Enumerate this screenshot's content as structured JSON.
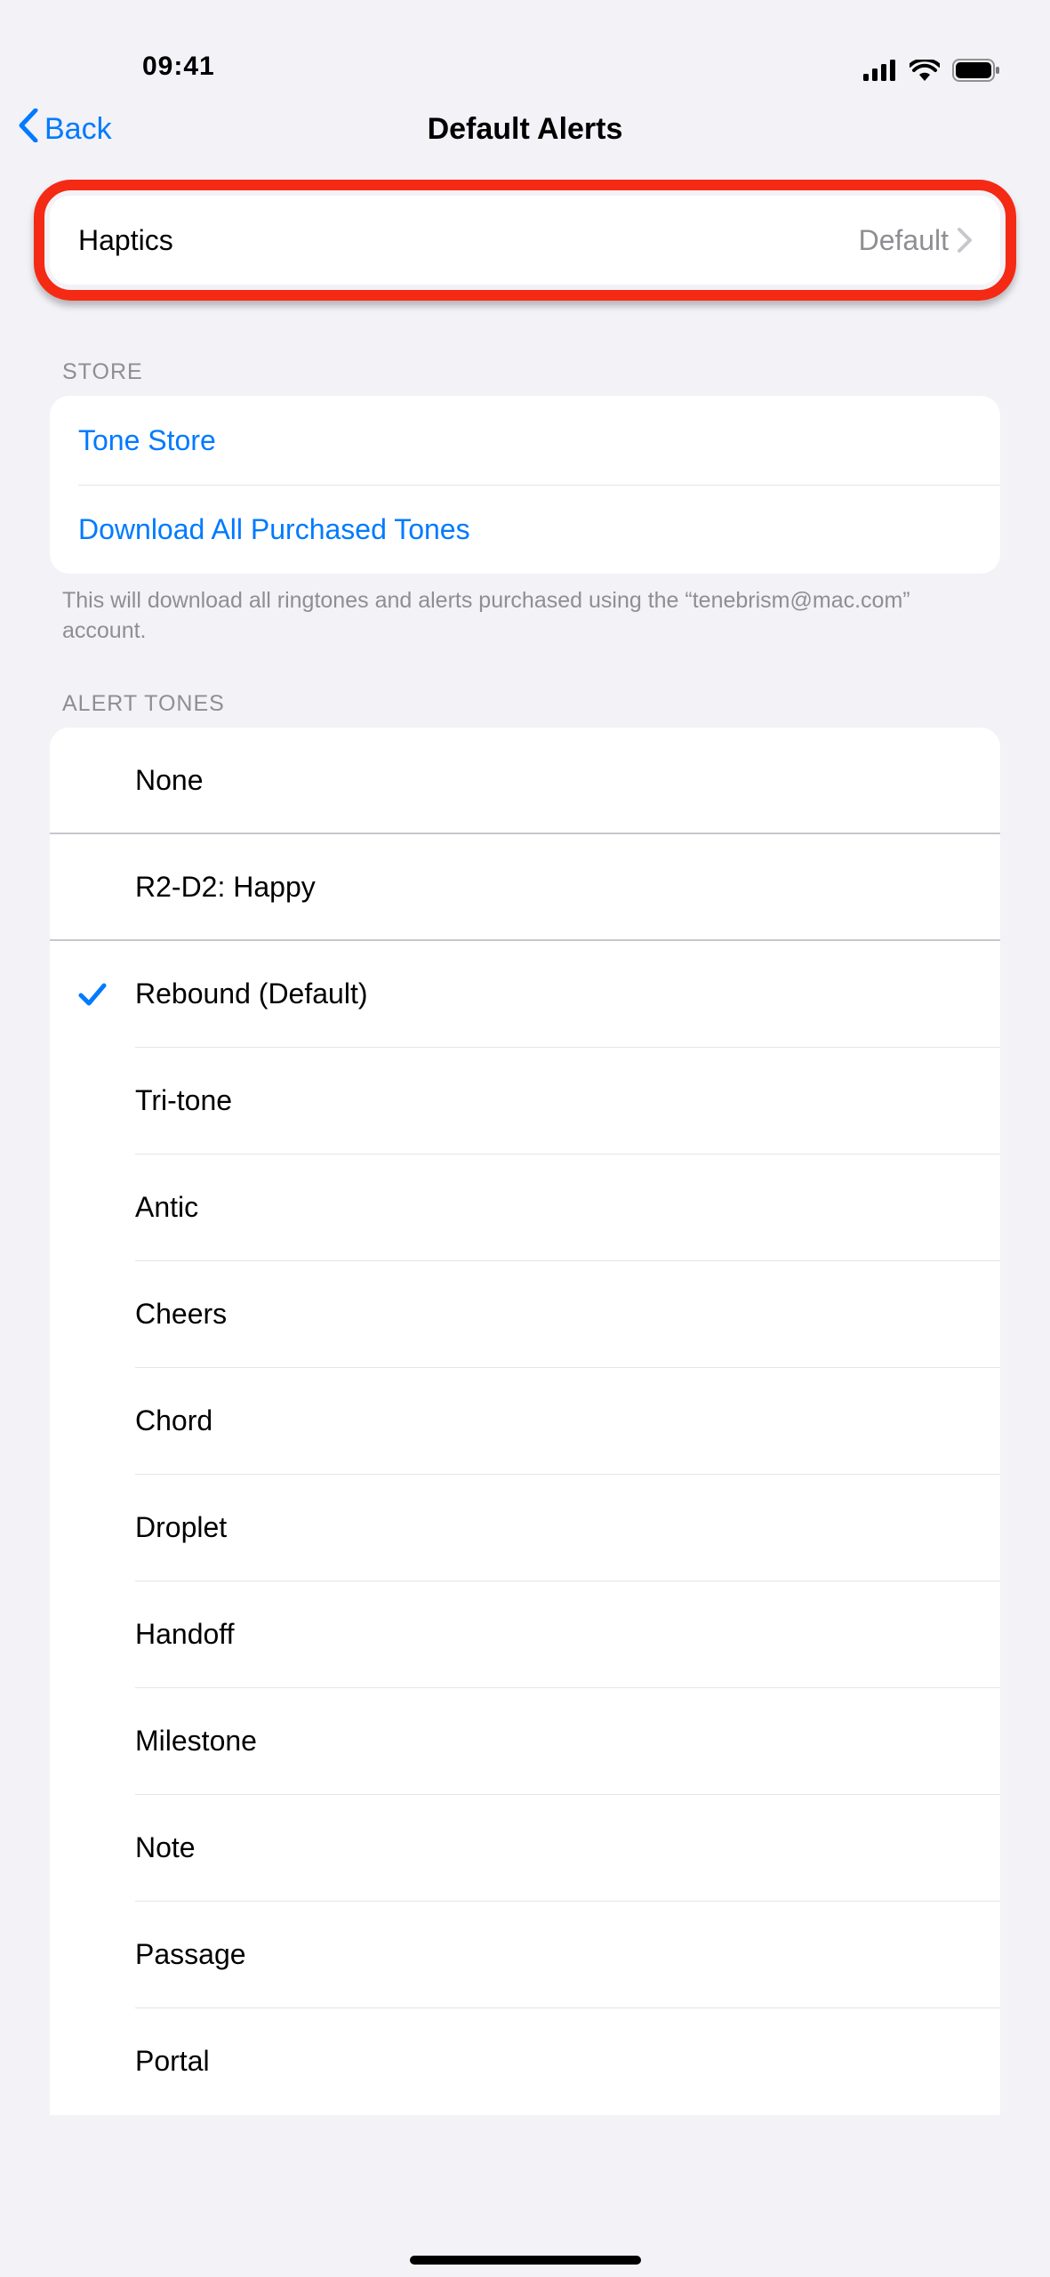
{
  "status": {
    "time": "09:41"
  },
  "nav": {
    "back": "Back",
    "title": "Default Alerts"
  },
  "haptics": {
    "label": "Haptics",
    "value": "Default"
  },
  "store": {
    "header": "STORE",
    "tone_store": "Tone Store",
    "download": "Download All Purchased Tones",
    "footer": "This will download all ringtones and alerts purchased using the “tenebrism@mac.com” account."
  },
  "alert_tones": {
    "header": "ALERT TONES",
    "items": [
      {
        "label": "None",
        "selected": false,
        "style": "full"
      },
      {
        "label": "R2-D2: Happy",
        "selected": false,
        "style": "full"
      },
      {
        "label": "Rebound (Default)",
        "selected": true,
        "style": "inner"
      },
      {
        "label": "Tri-tone",
        "selected": false,
        "style": "inner"
      },
      {
        "label": "Antic",
        "selected": false,
        "style": "inner"
      },
      {
        "label": "Cheers",
        "selected": false,
        "style": "inner"
      },
      {
        "label": "Chord",
        "selected": false,
        "style": "inner"
      },
      {
        "label": "Droplet",
        "selected": false,
        "style": "inner"
      },
      {
        "label": "Handoff",
        "selected": false,
        "style": "inner"
      },
      {
        "label": "Milestone",
        "selected": false,
        "style": "inner"
      },
      {
        "label": "Note",
        "selected": false,
        "style": "inner"
      },
      {
        "label": "Passage",
        "selected": false,
        "style": "inner"
      },
      {
        "label": "Portal",
        "selected": false,
        "style": "none"
      }
    ]
  }
}
